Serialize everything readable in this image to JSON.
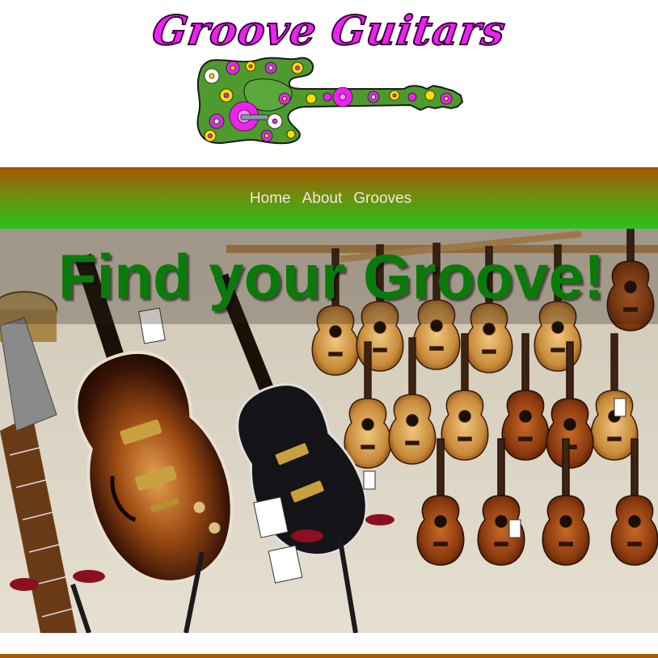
{
  "header": {
    "brand_title": "Groove Guitars",
    "logo_icon": "flower-guitar-icon"
  },
  "nav": {
    "items": [
      {
        "label": "Home"
      },
      {
        "label": "About"
      },
      {
        "label": "Grooves"
      }
    ]
  },
  "hero": {
    "heading": "Find your Groove!",
    "image": "guitar-shop-wall-photo"
  },
  "colors": {
    "brand_pink": "#ee22ee",
    "nav_top": "#a45a05",
    "nav_bottom": "#2ac21e",
    "heading_green": "#0a7a0a",
    "nav_text": "#f5e8d8"
  }
}
